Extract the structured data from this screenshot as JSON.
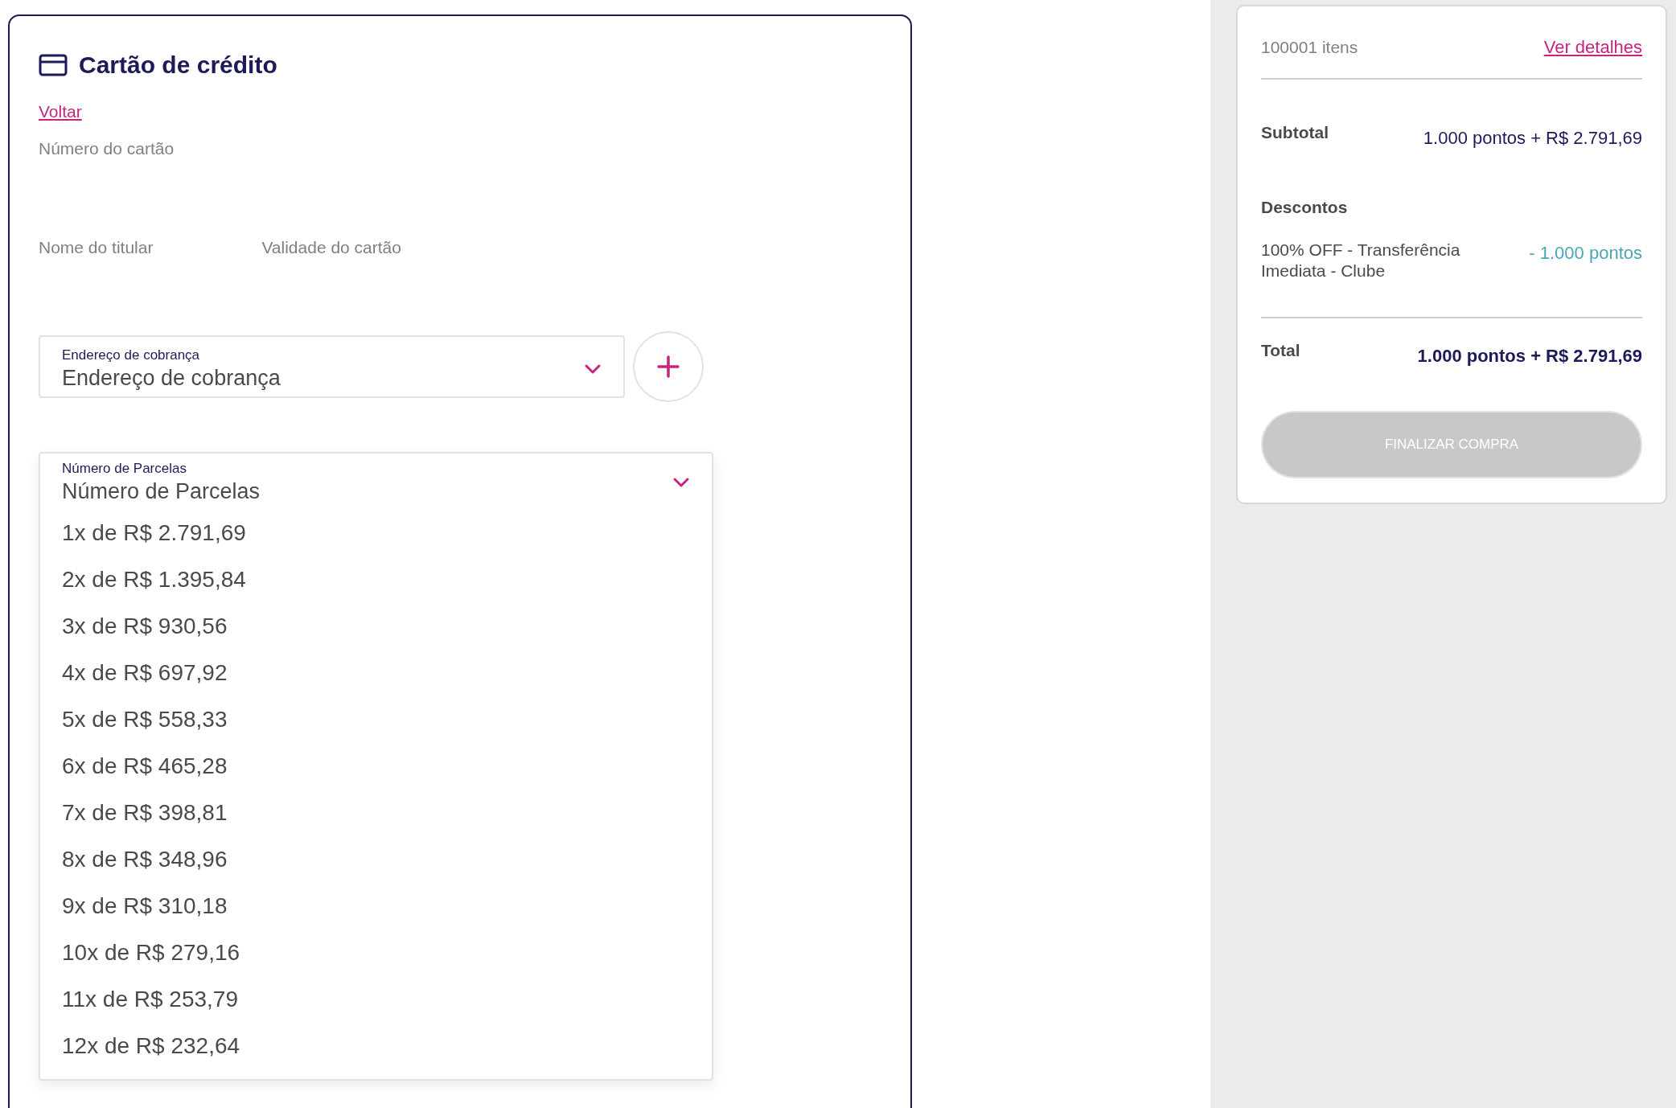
{
  "payment": {
    "title": "Cartão de crédito",
    "back_link": "Voltar",
    "fields": [
      {
        "label": "Número do cartão"
      },
      {
        "label": "Nome do titular"
      },
      {
        "label": "Validade do cartão"
      }
    ],
    "billing_address": {
      "floating_label": "Endereço de cobrança",
      "placeholder": "Endereço de cobrança"
    },
    "installments": {
      "floating_label": "Número de Parcelas",
      "placeholder": "Número de Parcelas",
      "expanded": true,
      "options": [
        "1x de R$ 2.791,69",
        "2x de R$ 1.395,84",
        "3x de R$ 930,56",
        "4x de R$ 697,92",
        "5x de R$ 558,33",
        "6x de R$ 465,28",
        "7x de R$ 398,81",
        "8x de R$ 348,96",
        "9x de R$ 310,18",
        "10x de R$ 279,16",
        "11x de R$ 253,79",
        "12x de R$ 232,64"
      ]
    }
  },
  "summary": {
    "items_count": "100001 itens",
    "details_link": "Ver detalhes",
    "subtotal": {
      "label": "Subtotal",
      "value": "1.000 pontos + R$ 2.791,69"
    },
    "discounts": {
      "label": "Descontos",
      "items": [
        {
          "name": "100% OFF - Transferência Imediata - Clube",
          "value": "- 1.000 pontos"
        }
      ]
    },
    "total": {
      "label": "Total",
      "value": "1.000 pontos + R$ 2.791,69"
    },
    "button": {
      "label": "FINALIZAR COMPRA",
      "disabled": true
    }
  }
}
